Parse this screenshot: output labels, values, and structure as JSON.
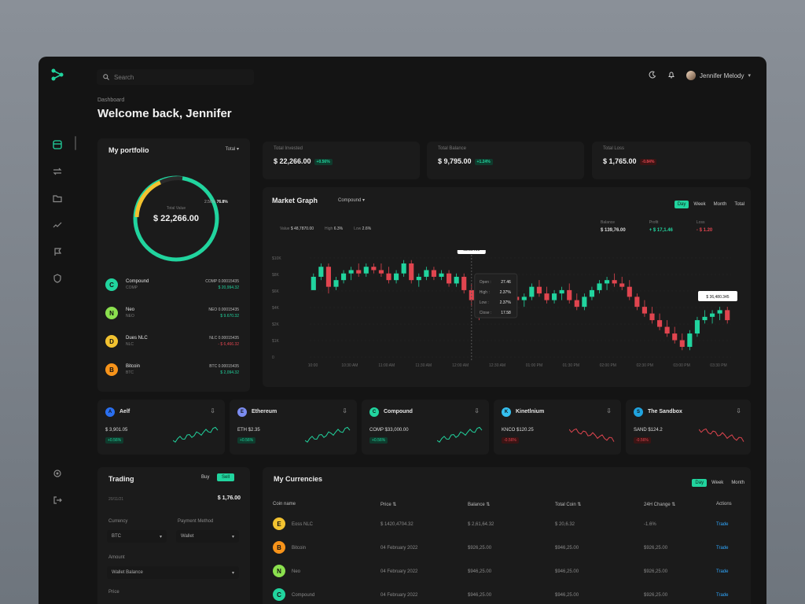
{
  "search": {
    "placeholder": "Search"
  },
  "user": {
    "name": "Jennifer Melody"
  },
  "breadcrumb": "Dashboard",
  "greeting": "Welcome back, Jennifer",
  "portfolio": {
    "title": "My portfolio",
    "filter": "Total",
    "donut_label": "Total Value",
    "donut_value": "$ 22,266.00",
    "donut_small": "2.56%",
    "donut_pct": "76.8%",
    "coins": [
      {
        "name": "Compound",
        "sym": "COMP",
        "amount": "COMP 0.00015435",
        "usd": "$ 20,994.32",
        "color": "#21d49e",
        "glyph": "C",
        "up": true
      },
      {
        "name": "Neo",
        "sym": "NEO",
        "amount": "NEO 0.00015435",
        "usd": "$ 9.670.32",
        "color": "#8be04e",
        "glyph": "N",
        "up": true
      },
      {
        "name": "Dues NLC",
        "sym": "NLC",
        "amount": "NLC 0.00015435",
        "usd": "- $ 6,466.32",
        "color": "#f2c230",
        "glyph": "D",
        "up": false
      },
      {
        "name": "Bitcoin",
        "sym": "BTC",
        "amount": "BTC 0.00015435",
        "usd": "$ 2,094.32",
        "color": "#f7931a",
        "glyph": "B",
        "up": true
      }
    ]
  },
  "stats": [
    {
      "label": "Total Invested",
      "value": "$ 22,266.00",
      "change": "+0.56%",
      "up": true
    },
    {
      "label": "Total Balance",
      "value": "$ 9,795.00",
      "change": "+1.24%",
      "up": true
    },
    {
      "label": "Total Loss",
      "value": "$ 1,765.00",
      "change": "-0.84%",
      "up": false
    }
  ],
  "market": {
    "title": "Market Graph",
    "coin": "Compound",
    "timeframes": [
      "Day",
      "Week",
      "Month",
      "Total"
    ],
    "active_tf": "Day",
    "ohlc": [
      {
        "label": "Value",
        "value": "$ 48,7870.00"
      },
      {
        "label": "High",
        "value": "6.3%"
      },
      {
        "label": "Low",
        "value": "2.6%"
      }
    ],
    "summary": [
      {
        "label": "Balance",
        "value": "$ 139,76.00",
        "cls": ""
      },
      {
        "label": "Profit",
        "value": "+ $ 17,1.46",
        "cls": "green"
      },
      {
        "label": "Loss",
        "value": "- $ 1.20",
        "cls": "red"
      }
    ],
    "y_ticks": [
      "$10K",
      "$8K",
      "$6K",
      "$4K",
      "$2K",
      "$1K",
      "0"
    ],
    "x_ticks": [
      "10:00",
      "10:30 AM",
      "11:00 AM",
      "11:30 AM",
      "12:00 AM",
      "12:30 AM",
      "01:00 PM",
      "01:30 PM",
      "02:00 PM",
      "02:30 PM",
      "03:00 PM",
      "03:30 PM"
    ],
    "time_tip": "08:00 AM",
    "price_tip": "$ 36,480.345",
    "tooltip": [
      {
        "label": "Open",
        "value": "27.46"
      },
      {
        "label": "High",
        "value": "2.37%"
      },
      {
        "label": "Low",
        "value": "2.37%"
      },
      {
        "label": "Close",
        "value": "17.58"
      }
    ]
  },
  "chart_data": {
    "type": "candlestick",
    "title": "Market Graph",
    "x": [
      "10:00",
      "10:30 AM",
      "11:00 AM",
      "11:30 AM",
      "12:00 AM",
      "12:30 AM",
      "01:00 PM",
      "01:30 PM",
      "02:00 PM",
      "02:30 PM",
      "03:00 PM",
      "03:30 PM"
    ],
    "candles": [
      [
        5.1,
        5.6,
        5.3,
        5.5
      ],
      [
        5.5,
        5.9,
        5.4,
        5.8
      ],
      [
        5.8,
        5.9,
        5.0,
        5.2
      ],
      [
        5.2,
        5.5,
        5.1,
        5.4
      ],
      [
        5.4,
        5.7,
        5.3,
        5.6
      ],
      [
        5.6,
        5.8,
        5.4,
        5.7
      ],
      [
        5.7,
        5.9,
        5.5,
        5.6
      ],
      [
        5.6,
        5.9,
        5.5,
        5.8
      ],
      [
        5.8,
        5.9,
        5.6,
        5.7
      ],
      [
        5.7,
        5.9,
        5.5,
        5.6
      ],
      [
        5.6,
        5.8,
        5.3,
        5.4
      ],
      [
        5.4,
        5.7,
        5.3,
        5.6
      ],
      [
        5.6,
        6.0,
        5.5,
        5.9
      ],
      [
        5.9,
        6.0,
        5.3,
        5.4
      ],
      [
        5.4,
        5.6,
        5.2,
        5.5
      ],
      [
        5.5,
        5.8,
        5.4,
        5.7
      ],
      [
        5.7,
        5.8,
        5.4,
        5.5
      ],
      [
        5.5,
        5.7,
        5.4,
        5.6
      ],
      [
        5.6,
        5.7,
        5.2,
        5.3
      ],
      [
        5.3,
        5.6,
        5.2,
        5.5
      ],
      [
        5.5,
        5.6,
        5.0,
        5.1
      ],
      [
        5.1,
        5.3,
        4.6,
        4.8
      ],
      [
        4.8,
        5.2,
        4.2,
        4.4
      ],
      [
        4.4,
        5.0,
        4.3,
        4.9
      ],
      [
        4.9,
        5.0,
        4.6,
        4.7
      ],
      [
        4.7,
        5.0,
        4.5,
        4.8
      ],
      [
        4.8,
        5.0,
        4.6,
        4.9
      ],
      [
        4.9,
        5.1,
        4.7,
        4.8
      ],
      [
        4.8,
        5.0,
        4.6,
        4.9
      ],
      [
        4.9,
        5.3,
        4.8,
        5.2
      ],
      [
        5.2,
        5.4,
        4.9,
        5.0
      ],
      [
        5.0,
        5.2,
        4.7,
        4.8
      ],
      [
        4.8,
        5.1,
        4.7,
        5.0
      ],
      [
        5.0,
        5.2,
        4.8,
        5.1
      ],
      [
        5.1,
        5.3,
        4.7,
        4.8
      ],
      [
        4.8,
        5.0,
        4.5,
        4.6
      ],
      [
        4.6,
        5.0,
        4.5,
        4.9
      ],
      [
        4.9,
        5.2,
        4.8,
        5.1
      ],
      [
        5.1,
        5.4,
        5.0,
        5.3
      ],
      [
        5.3,
        5.5,
        5.1,
        5.4
      ],
      [
        5.4,
        5.6,
        5.2,
        5.3
      ],
      [
        5.3,
        5.5,
        5.1,
        5.2
      ],
      [
        5.2,
        5.4,
        4.8,
        4.9
      ],
      [
        4.9,
        5.0,
        4.5,
        4.6
      ],
      [
        4.6,
        4.8,
        4.3,
        4.4
      ],
      [
        4.4,
        4.6,
        4.1,
        4.2
      ],
      [
        4.2,
        4.4,
        3.9,
        4.0
      ],
      [
        4.0,
        4.2,
        3.7,
        3.8
      ],
      [
        3.8,
        4.0,
        3.5,
        3.6
      ],
      [
        3.6,
        3.8,
        3.3,
        3.4
      ],
      [
        3.4,
        3.9,
        3.3,
        3.8
      ],
      [
        3.8,
        4.3,
        3.7,
        4.2
      ],
      [
        4.2,
        4.5,
        4.1,
        4.3
      ],
      [
        4.3,
        4.5,
        4.1,
        4.4
      ],
      [
        4.4,
        4.6,
        4.2,
        4.5
      ],
      [
        4.5,
        4.6,
        4.1,
        4.2
      ]
    ]
  },
  "watch": [
    {
      "name": "Aelf",
      "value": "$ 3,901.05",
      "change": "+0.56%",
      "up": true,
      "color": "#2a6ff0",
      "glyph": "A"
    },
    {
      "name": "Ethereum",
      "value": "ETH $2.35",
      "change": "+0.56%",
      "up": true,
      "color": "#7b8cf0",
      "glyph": "E"
    },
    {
      "name": "Compound",
      "value": "COMP $33,000.00",
      "change": "+0.56%",
      "up": true,
      "color": "#21d49e",
      "glyph": "C"
    },
    {
      "name": "Kinetlnium",
      "value": "KNCO $120.25",
      "change": "-0.56%",
      "up": false,
      "color": "#35c0f0",
      "glyph": "K"
    },
    {
      "name": "The Sandbox",
      "value": "SAND $124.2",
      "change": "-0.56%",
      "up": false,
      "color": "#20a4e0",
      "glyph": "S"
    }
  ],
  "trading": {
    "title": "Trading",
    "buy": "Buy",
    "sell": "Sell",
    "date": "20/11/21",
    "amount_top": "$ 1,76.00",
    "currency_label": "Currency",
    "currency_value": "BTC",
    "payment_label": "Payment Method",
    "payment_value": "Wallet",
    "amount_label": "Amount",
    "amount_value": "Wallet Balance",
    "price_label": "Price"
  },
  "currencies": {
    "title": "My Currencies",
    "timeframes": [
      "Day",
      "Week",
      "Month"
    ],
    "active_tf": "Day",
    "headers": [
      "Coin name",
      "Price",
      "Balance",
      "Total Coin",
      "24H Change",
      "Actions"
    ],
    "rows": [
      {
        "name": "Eoss NLC",
        "price": "$ 1420,4704.32",
        "balance": "$ 2,61,64.32",
        "total": "$ 20,6.32",
        "change": "-1.6%",
        "action": "Trade",
        "color": "#f2c230",
        "glyph": "E",
        "up": false
      },
      {
        "name": "Bitcoin",
        "price": "04 February 2022",
        "balance": "$926,25.00",
        "total": "$946,25.00",
        "change": "$926,25.00",
        "action": "Trade",
        "color": "#f7931a",
        "glyph": "B",
        "up": true
      },
      {
        "name": "Neo",
        "price": "04 February 2022",
        "balance": "$946,25.00",
        "total": "$946,25.00",
        "change": "$926,25.00",
        "action": "Trade",
        "color": "#8be04e",
        "glyph": "N",
        "up": true
      },
      {
        "name": "Compound",
        "price": "04 February 2022",
        "balance": "$946,25.00",
        "total": "$946,25.00",
        "change": "$926,25.00",
        "action": "Trade",
        "color": "#21d49e",
        "glyph": "C",
        "up": true
      }
    ]
  },
  "colors": {
    "accent": "#21d49e",
    "danger": "#e0454f",
    "background": "#141414",
    "card": "#1b1b1b"
  }
}
